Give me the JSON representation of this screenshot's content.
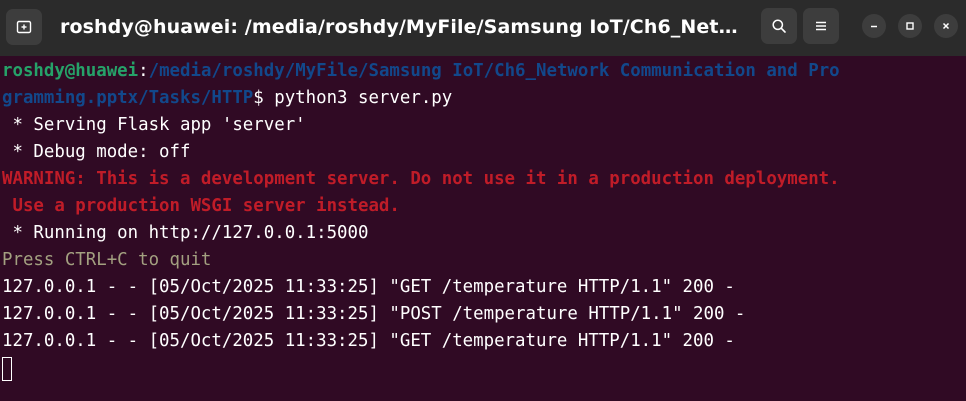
{
  "titlebar": {
    "title": "roshdy@huawei: /media/roshdy/MyFile/Samsung IoT/Ch6_Netw…",
    "new_tab_icon": "new-tab-icon",
    "search_icon": "search-icon",
    "menu_icon": "hamburger-menu-icon",
    "minimize_icon": "minimize-icon",
    "maximize_icon": "maximize-icon",
    "close_icon": "close-icon"
  },
  "terminal": {
    "prompt_user": "roshdy@huawei",
    "prompt_colon": ":",
    "prompt_path_1": "/media/roshdy/MyFile/Samsung IoT/Ch6_Network Communication and Pro",
    "prompt_path_2": "gramming.pptx/Tasks/HTTP",
    "prompt_dollar": "$ ",
    "command": "python3 server.py",
    "out_serving": " * Serving Flask app 'server'",
    "out_debug": " * Debug mode: off",
    "warn_1": "WARNING: This is a development server. Do not use it in a production deployment.",
    "warn_2": " Use a production WSGI server instead.",
    "out_running": " * Running on http://127.0.0.1:5000",
    "out_quit": "Press CTRL+C to quit",
    "log_lines": [
      "127.0.0.1 - - [05/Oct/2025 11:33:25] \"GET /temperature HTTP/1.1\" 200 -",
      "127.0.0.1 - - [05/Oct/2025 11:33:25] \"POST /temperature HTTP/1.1\" 200 -",
      "127.0.0.1 - - [05/Oct/2025 11:33:25] \"GET /temperature HTTP/1.1\" 200 -"
    ]
  },
  "colors": {
    "background": "#300a24",
    "titlebar": "#2b2b2b",
    "user": "#26a269",
    "path": "#12488b",
    "warning": "#c01c28",
    "dim": "#a3a080",
    "text": "#ffffff"
  }
}
